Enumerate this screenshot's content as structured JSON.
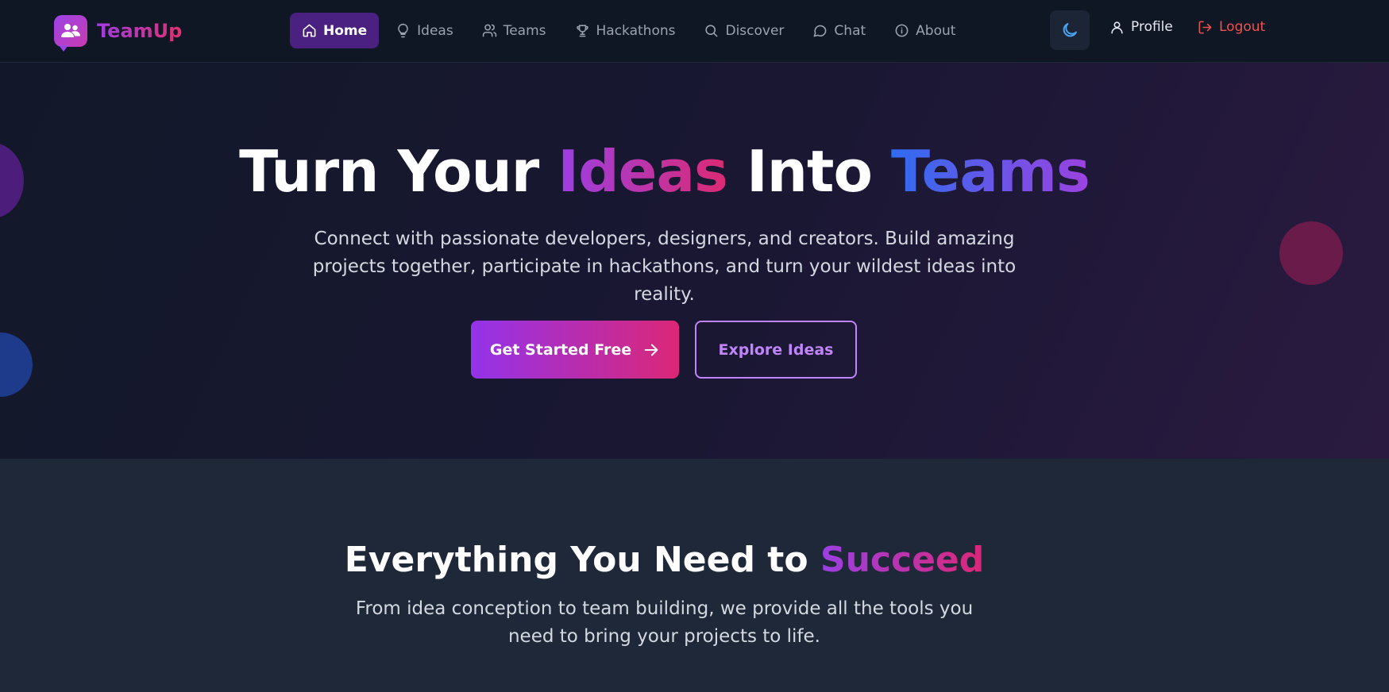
{
  "brand": {
    "name": "TeamUp"
  },
  "nav": {
    "items": [
      {
        "label": "Home",
        "icon": "home-icon",
        "active": true
      },
      {
        "label": "Ideas",
        "icon": "lightbulb-icon",
        "active": false
      },
      {
        "label": "Teams",
        "icon": "users-icon",
        "active": false
      },
      {
        "label": "Hackathons",
        "icon": "trophy-icon",
        "active": false
      },
      {
        "label": "Discover",
        "icon": "search-icon",
        "active": false
      },
      {
        "label": "Chat",
        "icon": "chat-bubble-icon",
        "active": false
      },
      {
        "label": "About",
        "icon": "info-icon",
        "active": false
      }
    ],
    "profile_label": "Profile",
    "logout_label": "Logout"
  },
  "hero": {
    "title_part1": "Turn Your ",
    "title_highlight1": "Ideas",
    "title_part2": " Into ",
    "title_highlight2": "Teams",
    "subtitle": "Connect with passionate developers, designers, and creators. Build amazing projects together, participate in hackathons, and turn your wildest ideas into reality.",
    "primary_cta": "Get Started Free",
    "secondary_cta": "Explore Ideas"
  },
  "features": {
    "title_part1": "Everything You Need to ",
    "title_highlight": "Succeed",
    "subtitle": "From idea conception to team building, we provide all the tools you need to bring your projects to life."
  },
  "colors": {
    "accent_purple": "#9333ea",
    "accent_pink": "#db2777",
    "accent_blue": "#2f6cf0",
    "logout_red": "#ef5350"
  }
}
